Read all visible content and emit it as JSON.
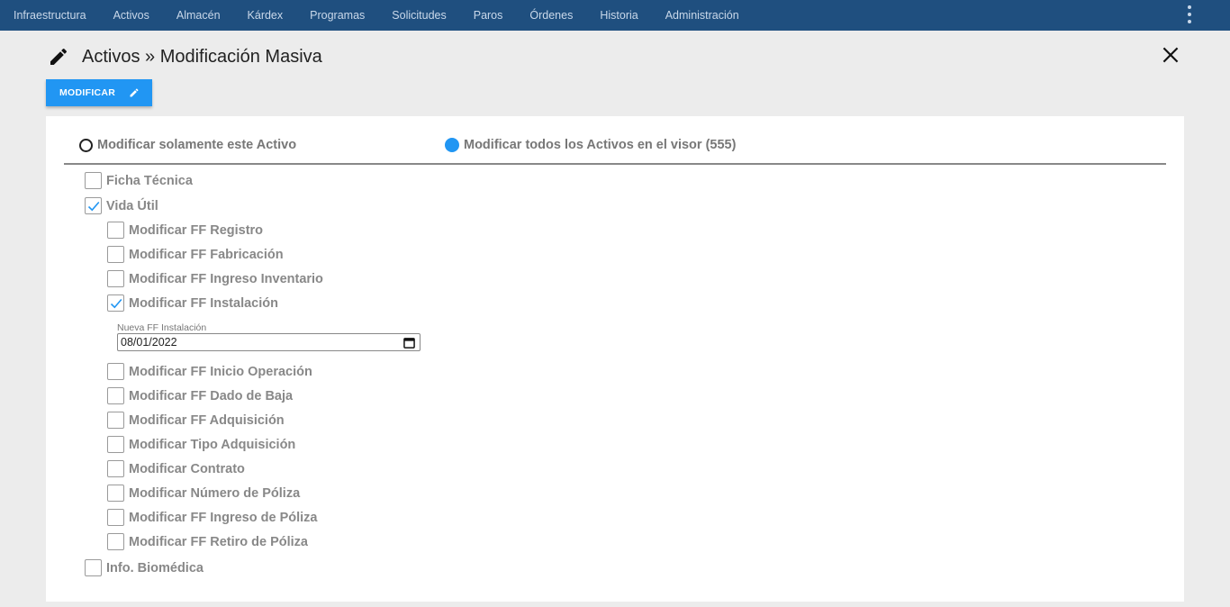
{
  "nav": {
    "items": [
      "Infraestructura",
      "Activos",
      "Almacén",
      "Kárdex",
      "Programas",
      "Solicitudes",
      "Paros",
      "Órdenes",
      "Historia",
      "Administración"
    ]
  },
  "header": {
    "title": "Activos » Modificación Masiva",
    "modify_button": "MODIFICAR"
  },
  "scope": {
    "option_single": "Modificar solamente este Activo",
    "option_all": "Modificar todos los Activos en el visor (555)",
    "selected": "all"
  },
  "sections": {
    "ficha": {
      "label": "Ficha Técnica",
      "checked": false
    },
    "vida": {
      "label": "Vida Útil",
      "checked": true
    },
    "info": {
      "label": "Info. Biomédica",
      "checked": false
    }
  },
  "vida_items": [
    {
      "label": "Modificar FF Registro",
      "checked": false
    },
    {
      "label": "Modificar FF Fabricación",
      "checked": false
    },
    {
      "label": "Modificar FF Ingreso Inventario",
      "checked": false
    },
    {
      "label": "Modificar FF Instalación",
      "checked": true
    },
    {
      "label": "Modificar FF Inicio Operación",
      "checked": false
    },
    {
      "label": "Modificar FF Dado de Baja",
      "checked": false
    },
    {
      "label": "Modificar FF Adquisición",
      "checked": false
    },
    {
      "label": "Modificar Tipo Adquisición",
      "checked": false
    },
    {
      "label": "Modificar Contrato",
      "checked": false
    },
    {
      "label": "Modificar Número de Póliza",
      "checked": false
    },
    {
      "label": "Modificar FF Ingreso de Póliza",
      "checked": false
    },
    {
      "label": "Modificar FF Retiro de Póliza",
      "checked": false
    }
  ],
  "date_field": {
    "label": "Nueva FF Instalación",
    "value": "08/01/2022"
  },
  "colors": {
    "nav_bg": "#1f4f7f",
    "accent": "#2196f3"
  }
}
